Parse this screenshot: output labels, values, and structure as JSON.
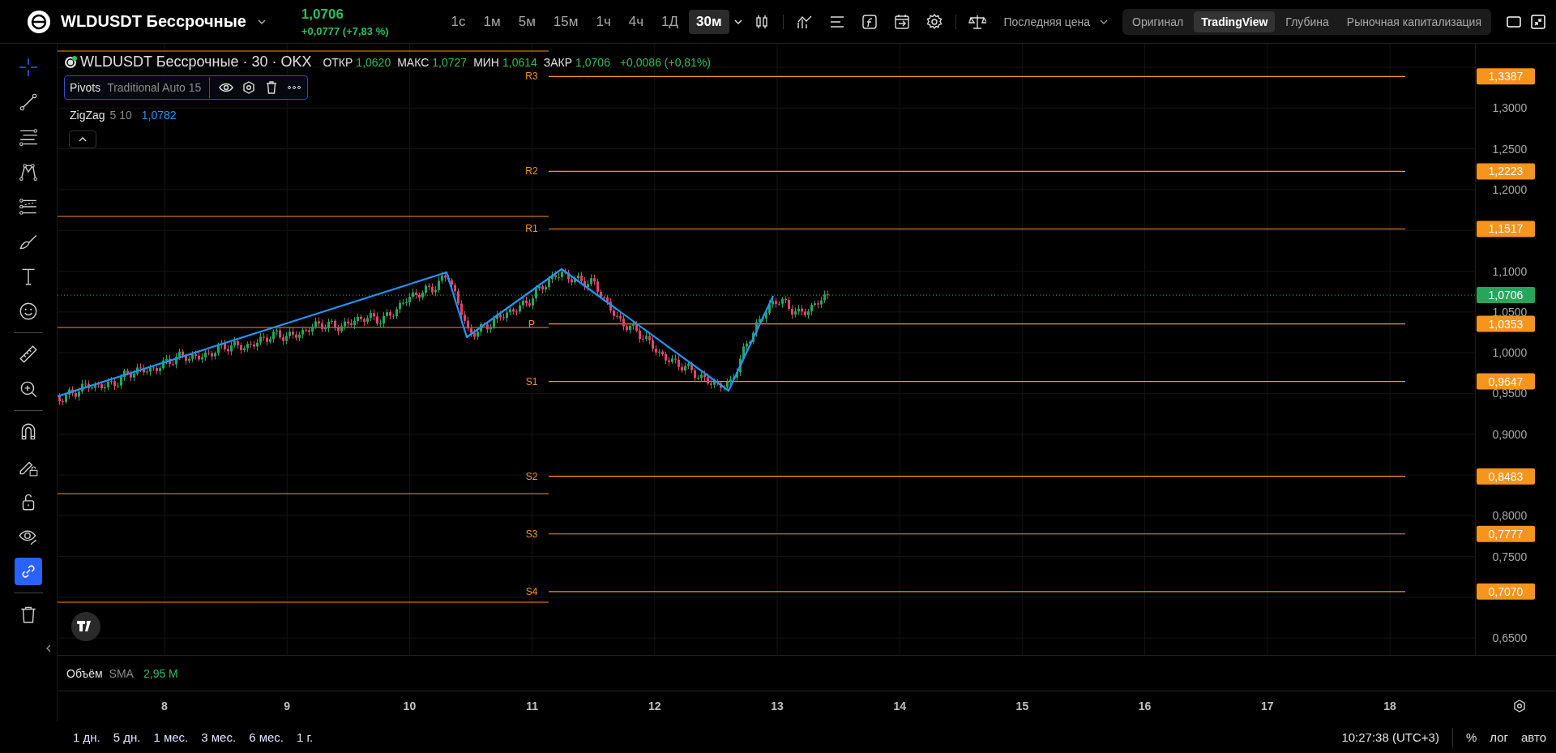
{
  "header": {
    "symbol": "WLDUSDT Бессрочные",
    "price": "1,0706",
    "change": "+0,0777 (+7,83 %)"
  },
  "intervals": [
    {
      "label": "1с",
      "selected": false
    },
    {
      "label": "1м",
      "selected": false
    },
    {
      "label": "5м",
      "selected": false
    },
    {
      "label": "15м",
      "selected": false
    },
    {
      "label": "1ч",
      "selected": false
    },
    {
      "label": "4ч",
      "selected": false
    },
    {
      "label": "1Д",
      "selected": false
    },
    {
      "label": "30м",
      "selected": true
    }
  ],
  "price_source": "Последняя цена",
  "views": [
    {
      "label": "Оригинал",
      "selected": false
    },
    {
      "label": "TradingView",
      "selected": true
    },
    {
      "label": "Глубина",
      "selected": false
    },
    {
      "label": "Рыночная капитализация",
      "selected": false
    }
  ],
  "toolbar": {
    "tools": [
      {
        "selected": true
      },
      {
        "selected": false
      },
      {
        "selected": false
      },
      {
        "selected": false
      },
      {
        "selected": false
      },
      {
        "selected": false
      },
      {
        "selected": false
      },
      {
        "selected": false
      },
      {
        "selected": false
      },
      {
        "selected": false
      },
      {
        "selected": false
      },
      {
        "selected": false
      },
      {
        "selected": false
      },
      {
        "selected": false
      },
      {
        "selected": true
      },
      {
        "selected": false
      }
    ]
  },
  "legend": {
    "title": "WLDUSDT Бессрочные · 30 · OKX",
    "ohlc": [
      {
        "label": "ОТКР",
        "value": "1,0620"
      },
      {
        "label": "МАКС",
        "value": "1,0727"
      },
      {
        "label": "МИН",
        "value": "1,0614"
      },
      {
        "label": "ЗАКР",
        "value": "1,0706"
      }
    ],
    "change": "+0,0086 (+0,81%)"
  },
  "indicators": [
    {
      "name": "Pivots",
      "params": "Traditional Auto 15",
      "selected": true
    },
    {
      "name": "ZigZag",
      "params": "5 10",
      "value": "1,0782",
      "selected": false
    }
  ],
  "pivots": [
    {
      "label": "R3",
      "price": "1,3387"
    },
    {
      "label": "R2",
      "price": "1,2223"
    },
    {
      "label": "R1",
      "price": "1,1517"
    },
    {
      "label": "P",
      "price": "1,0353"
    },
    {
      "label": "S1",
      "price": "0,9647"
    },
    {
      "label": "S2",
      "price": "0,8483"
    },
    {
      "label": "S3",
      "price": "0,7777"
    },
    {
      "label": "S4",
      "price": "0,7070"
    }
  ],
  "price_axis": {
    "ticks": [
      "1,3000",
      "1,2500",
      "1,2000",
      "1,1000",
      "1,0500",
      "1,0000",
      "0,9500",
      "0,9000",
      "0,8000",
      "0,7500",
      "0,6500"
    ],
    "last_price": "1,0706"
  },
  "volume": {
    "name": "Объём",
    "params": "SMA",
    "value": "2,95 M"
  },
  "time_axis": [
    "8",
    "9",
    "10",
    "11",
    "12",
    "13",
    "14",
    "15",
    "16",
    "17",
    "18"
  ],
  "ranges": [
    "1 дн.",
    "5 дн.",
    "1 мес.",
    "3 мес.",
    "6 мес.",
    "1 г."
  ],
  "clock": "10:27:38 (UTC+3)",
  "scale_options": [
    "%",
    "лог",
    "авто"
  ]
}
